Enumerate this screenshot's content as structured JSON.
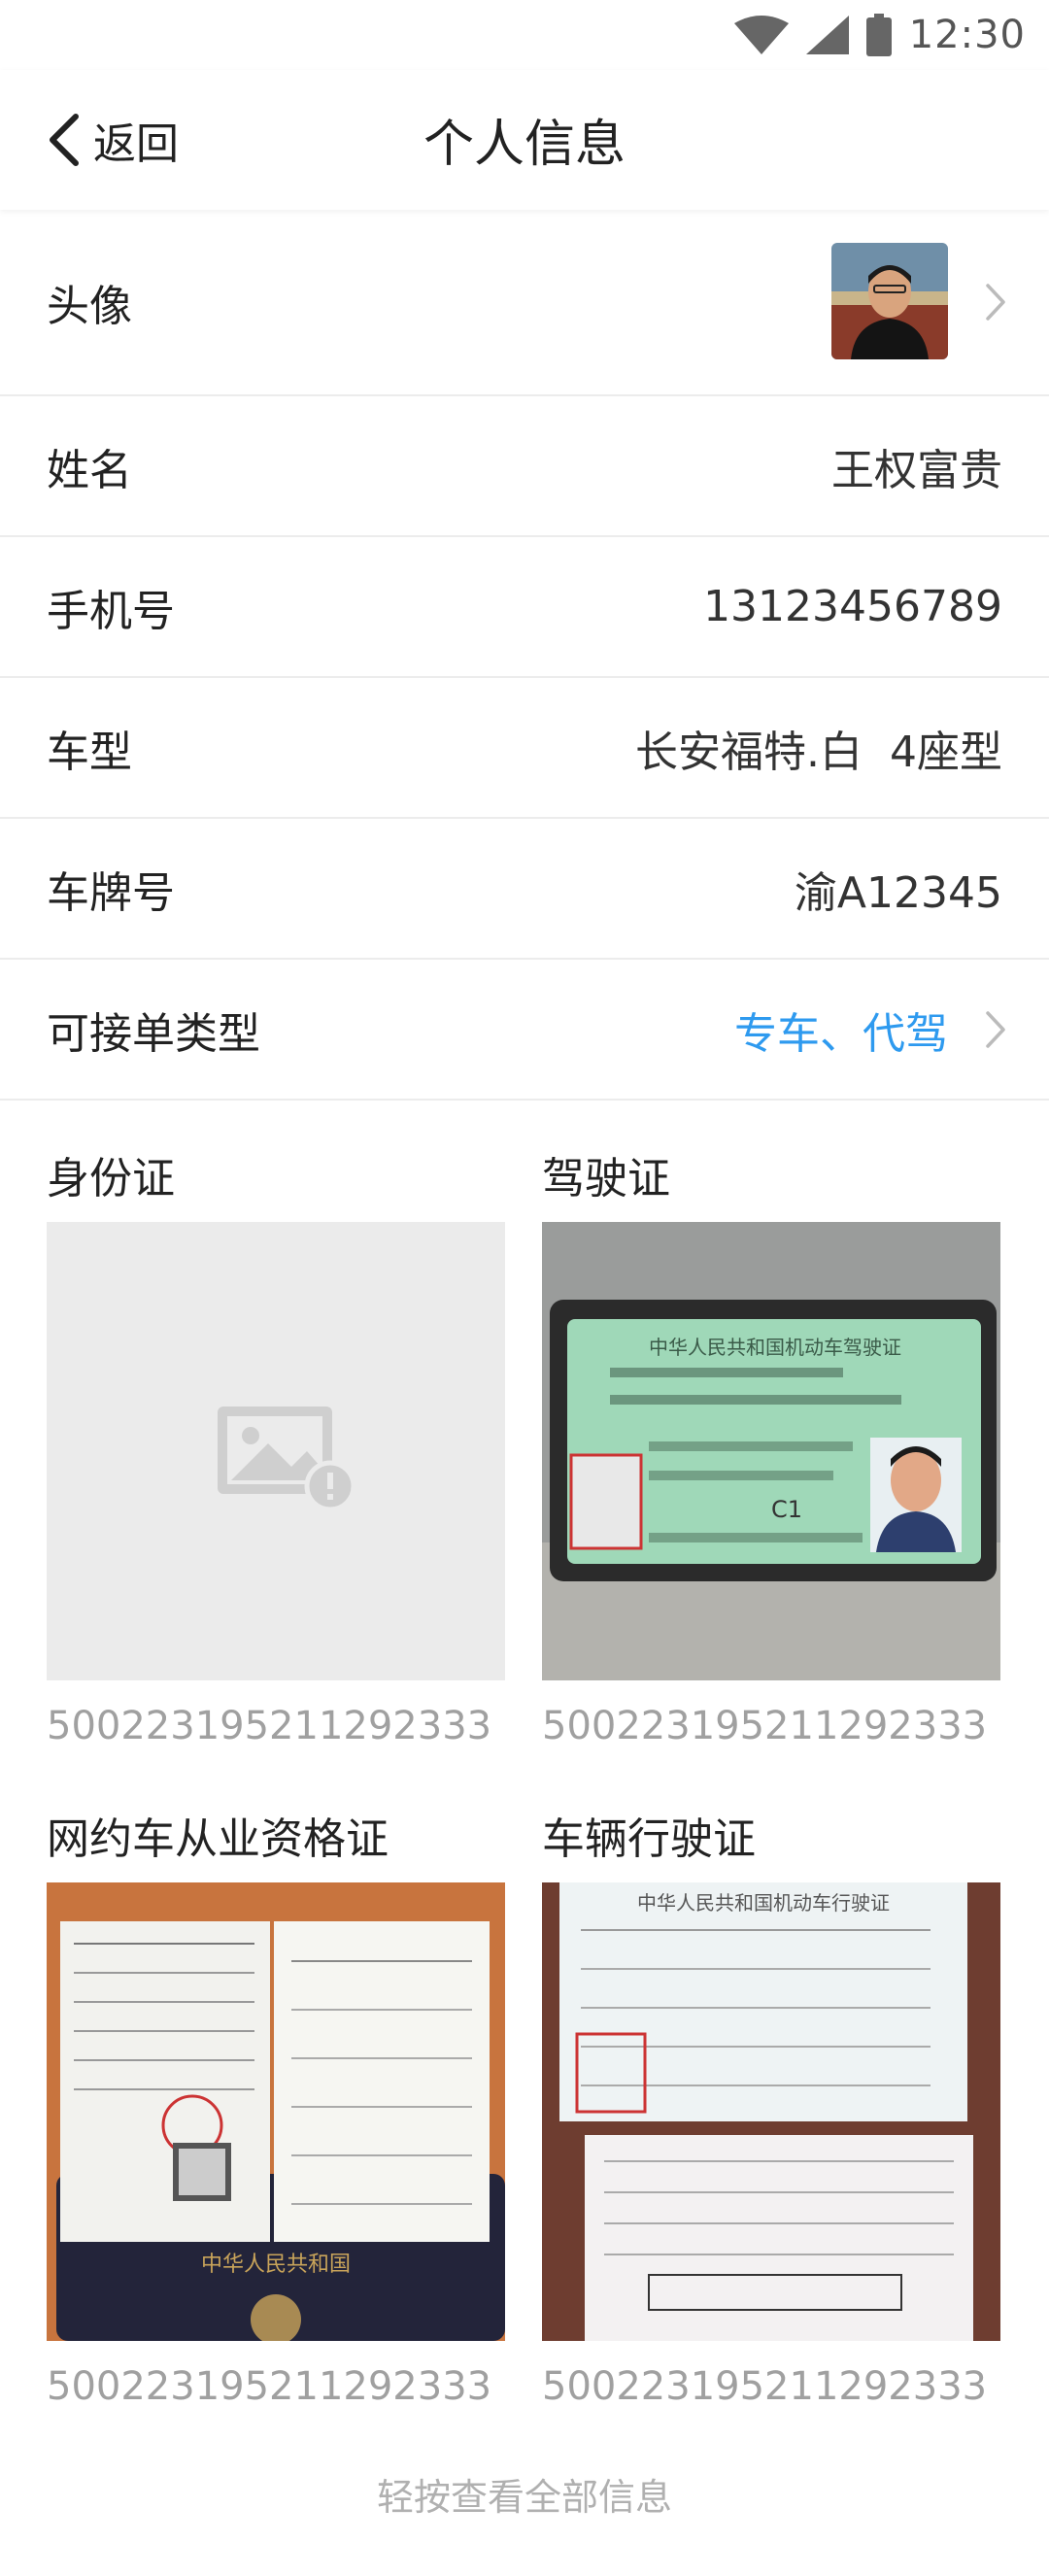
{
  "status": {
    "time": "12:30"
  },
  "nav": {
    "back_label": "返回",
    "title": "个人信息"
  },
  "profile": {
    "avatar_label": "头像",
    "rows": [
      {
        "label": "姓名",
        "value": "王权富贵"
      },
      {
        "label": "手机号",
        "value": "13123456789"
      },
      {
        "label": "车型",
        "value": "长安福特.白  4座型"
      },
      {
        "label": "车牌号",
        "value": "渝A12345"
      },
      {
        "label": "可接单类型",
        "value": "专车、代驾"
      }
    ]
  },
  "documents": [
    {
      "title": "身份证",
      "number": "500223195211292333",
      "image": "placeholder-image-icon"
    },
    {
      "title": "驾驶证",
      "number": "500223195211292333",
      "image": "drivers-license-photo"
    },
    {
      "title": "网约车从业资格证",
      "number": "500223195211292333",
      "image": "ride-hailing-qualification-photo"
    },
    {
      "title": "车辆行驶证",
      "number": "500223195211292333",
      "image": "vehicle-license-photo"
    }
  ],
  "license_text": {
    "driver_header": "中华人民共和国机动车驾驶证",
    "driver_class": "C1",
    "vehicle_header": "中华人民共和国机动车行驶证",
    "qual_cover": "中华人民共和国"
  },
  "footer": {
    "hint": "轻按查看全部信息"
  },
  "colors": {
    "accent": "#2e9aef",
    "muted": "#a0a0a0",
    "divider": "#ececec"
  }
}
